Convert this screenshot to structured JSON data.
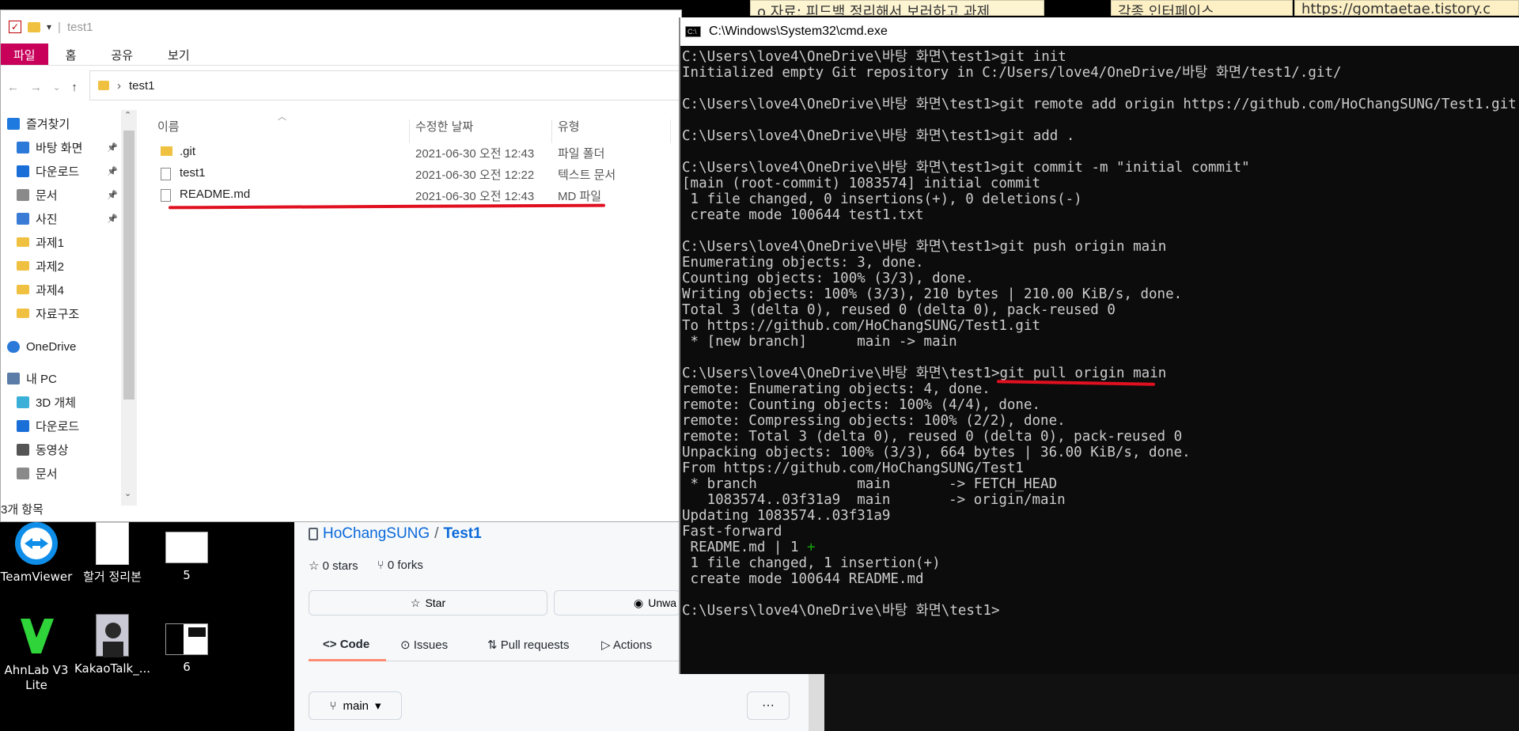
{
  "background_tabs": {
    "tab1": "o 자료: 피드백 정리해서 보러하고 과제",
    "tab2": "각종 인터페이스",
    "tab3": "https://gomtaetae.tistory.c"
  },
  "desktop_icons": [
    {
      "label": "TeamViewer"
    },
    {
      "label": "할거 정리본"
    },
    {
      "label": "5"
    },
    {
      "label": "AhnLab V3 Lite"
    },
    {
      "label": "KakaoTalk_..."
    },
    {
      "label": "6"
    }
  ],
  "github": {
    "owner": "HoChangSUNG",
    "separator": "/",
    "repo": "Test1",
    "stars": "0 stars",
    "forks": "0 forks",
    "star_button": "Star",
    "unwatch_button": "Unwa",
    "tabs": [
      "Code",
      "Issues",
      "Pull requests",
      "Actions"
    ],
    "branch": "main",
    "more": "···"
  },
  "explorer": {
    "title": "test1",
    "ribbon_tabs": [
      "파일",
      "홈",
      "공유",
      "보기"
    ],
    "address": "test1",
    "nav_items": [
      {
        "label": "즐겨찾기",
        "icon": "star-icon"
      },
      {
        "label": "바탕 화면",
        "icon": "desktop-icon",
        "pinned": true
      },
      {
        "label": "다운로드",
        "icon": "download-icon",
        "pinned": true
      },
      {
        "label": "문서",
        "icon": "document-icon",
        "pinned": true
      },
      {
        "label": "사진",
        "icon": "picture-icon",
        "pinned": true
      },
      {
        "label": "과제1",
        "icon": "folder-icon"
      },
      {
        "label": "과제2",
        "icon": "folder-icon"
      },
      {
        "label": "과제4",
        "icon": "folder-icon"
      },
      {
        "label": "자료구조",
        "icon": "folder-icon"
      },
      {
        "label": "OneDrive",
        "icon": "cloud-icon"
      },
      {
        "label": "내 PC",
        "icon": "pc-icon"
      },
      {
        "label": "3D 개체",
        "icon": "cube-icon"
      },
      {
        "label": "다운로드",
        "icon": "download-icon"
      },
      {
        "label": "동영상",
        "icon": "video-icon"
      },
      {
        "label": "문서",
        "icon": "document-icon"
      }
    ],
    "columns": {
      "name": "이름",
      "modified": "수정한 날짜",
      "type": "유형"
    },
    "files": [
      {
        "name": ".git",
        "modified": "2021-06-30 오전 12:43",
        "type": "파일 폴더",
        "icon": "folder-icon"
      },
      {
        "name": "test1",
        "modified": "2021-06-30 오전 12:22",
        "type": "텍스트 문서",
        "icon": "text-file-icon"
      },
      {
        "name": "README.md",
        "modified": "2021-06-30 오전 12:43",
        "type": "MD 파일",
        "icon": "file-icon"
      }
    ],
    "status": "3개 항목"
  },
  "cmd": {
    "title": "C:\\Windows\\System32\\cmd.exe",
    "lines": [
      "C:\\Users\\love4\\OneDrive\\바탕 화면\\test1>git init",
      "Initialized empty Git repository in C:/Users/love4/OneDrive/바탕 화면/test1/.git/",
      "",
      "C:\\Users\\love4\\OneDrive\\바탕 화면\\test1>git remote add origin https://github.com/HoChangSUNG/Test1.git",
      "",
      "C:\\Users\\love4\\OneDrive\\바탕 화면\\test1>git add .",
      "",
      "C:\\Users\\love4\\OneDrive\\바탕 화면\\test1>git commit -m \"initial commit\"",
      "[main (root-commit) 1083574] initial commit",
      " 1 file changed, 0 insertions(+), 0 deletions(-)",
      " create mode 100644 test1.txt",
      "",
      "C:\\Users\\love4\\OneDrive\\바탕 화면\\test1>git push origin main",
      "Enumerating objects: 3, done.",
      "Counting objects: 100% (3/3), done.",
      "Writing objects: 100% (3/3), 210 bytes | 210.00 KiB/s, done.",
      "Total 3 (delta 0), reused 0 (delta 0), pack-reused 0",
      "To https://github.com/HoChangSUNG/Test1.git",
      " * [new branch]      main -> main",
      "",
      "C:\\Users\\love4\\OneDrive\\바탕 화면\\test1>git pull origin main",
      "remote: Enumerating objects: 4, done.",
      "remote: Counting objects: 100% (4/4), done.",
      "remote: Compressing objects: 100% (2/2), done.",
      "remote: Total 3 (delta 0), reused 0 (delta 0), pack-reused 0",
      "Unpacking objects: 100% (3/3), 664 bytes | 36.00 KiB/s, done.",
      "From https://github.com/HoChangSUNG/Test1",
      " * branch            main       -> FETCH_HEAD",
      "   1083574..03f31a9  main       -> origin/main",
      "Updating 1083574..03f31a9",
      "Fast-forward",
      " README.md | 1 ",
      " 1 file changed, 1 insertion(+)",
      " create mode 100644 README.md",
      "",
      "C:\\Users\\love4\\OneDrive\\바탕 화면\\test1>"
    ],
    "plus_marker": "+"
  },
  "colors": {
    "highlight": "#e01020",
    "file_tab": "#c8005a",
    "github_link": "#0969da"
  }
}
